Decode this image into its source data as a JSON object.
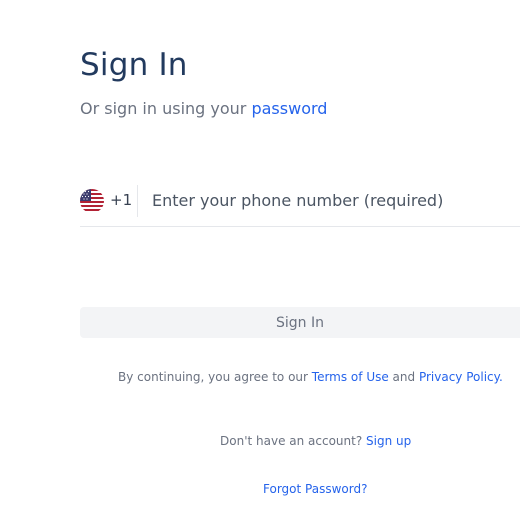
{
  "header": {
    "title": "Sign In",
    "subtitle_prefix": "Or sign in using your ",
    "subtitle_link": "password"
  },
  "phone": {
    "country_flag_icon": "us-flag-icon",
    "dial_code": "+1",
    "placeholder": "Enter your phone number (required)",
    "value": ""
  },
  "actions": {
    "sign_in_label": "Sign In"
  },
  "terms": {
    "prefix": "By continuing, you agree to our ",
    "terms_link": "Terms of Use",
    "middle": " and ",
    "privacy_link": "Privacy Policy."
  },
  "signup": {
    "prompt": "Don't have an account? ",
    "link": "Sign up"
  },
  "forgot": {
    "link": "Forgot Password?"
  },
  "colors": {
    "title": "#223a5e",
    "link": "#2563eb",
    "muted_text": "#6b7280",
    "button_bg": "#f3f4f6",
    "divider": "#e5e7eb"
  }
}
